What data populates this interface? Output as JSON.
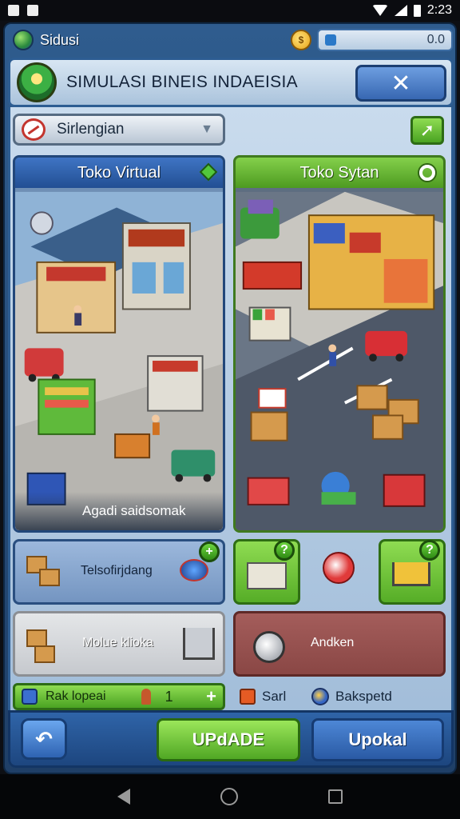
{
  "status_bar": {
    "time": "2:23"
  },
  "top_bar": {
    "app_name": "Sidusi",
    "search_value": "0.0"
  },
  "title_panel": {
    "title": "SIMULASI BINEIS INDAEISIA",
    "close_label": "✕"
  },
  "selector": {
    "label": "Sirlengian",
    "arrow_label": "➚"
  },
  "stores": [
    {
      "title": "Toko Virtual",
      "caption": "Agadi saidsomak",
      "accent": "#224f93"
    },
    {
      "title": "Toko Sytan",
      "caption": "",
      "accent": "#4d9a20"
    }
  ],
  "tiles": {
    "t1_label": "Telsofirjdang",
    "t1_badge": "+",
    "t2_badge": "?",
    "t3_badge": "?",
    "t4_label": "Molue klioka",
    "t5_label": "Andken"
  },
  "counter_bar": {
    "label": "Rak lopeai",
    "count": "1",
    "plus": "+"
  },
  "info": {
    "item1": "Sarl",
    "item2": "Bakspetd"
  },
  "actions": {
    "update": "UPdADE",
    "upload": "Upokal",
    "back_label": "↶"
  }
}
